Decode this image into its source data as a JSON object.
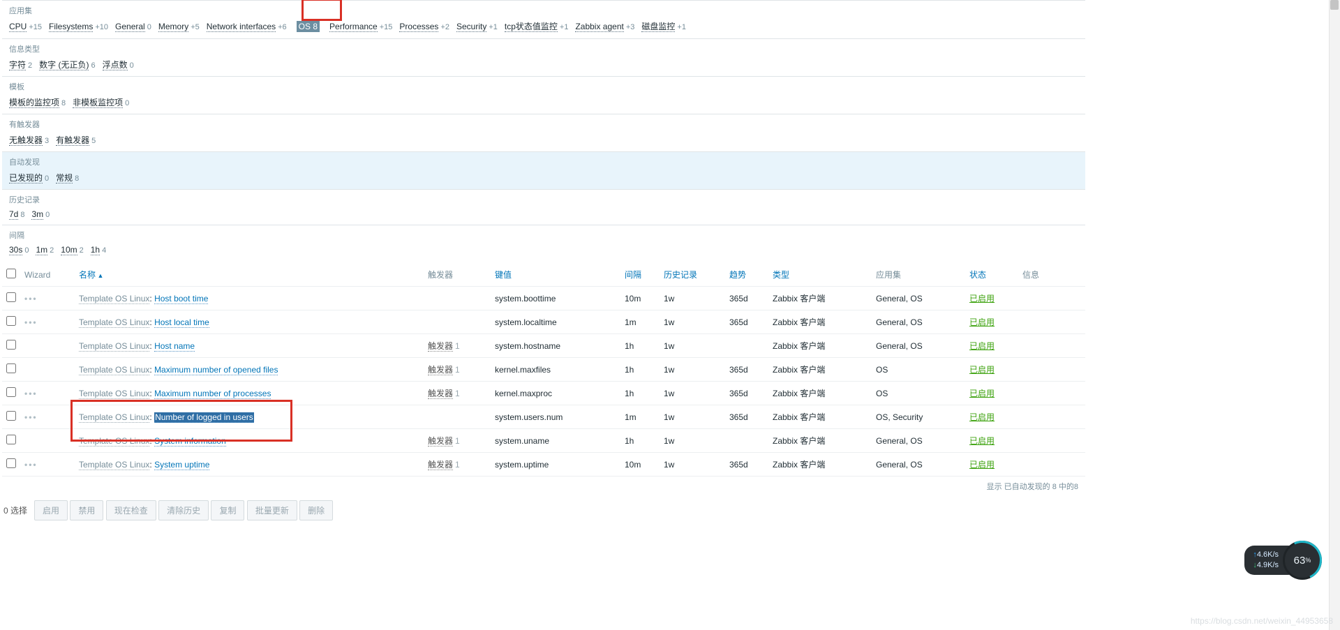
{
  "filters": {
    "app": {
      "label": "应用集",
      "items": [
        {
          "name": "CPU",
          "count": "+15"
        },
        {
          "name": "Filesystems",
          "count": "+10"
        },
        {
          "name": "General",
          "count": "0"
        },
        {
          "name": "Memory",
          "count": "+5"
        },
        {
          "name": "Network interfaces",
          "count": "+6"
        },
        {
          "name": "OS",
          "count": "8",
          "selected": true
        },
        {
          "name": "Performance",
          "count": "+15"
        },
        {
          "name": "Processes",
          "count": "+2"
        },
        {
          "name": "Security",
          "count": "+1"
        },
        {
          "name": "tcp状态值监控",
          "count": "+1"
        },
        {
          "name": "Zabbix agent",
          "count": "+3"
        },
        {
          "name": "磁盘监控",
          "count": "+1"
        }
      ]
    },
    "info": {
      "label": "信息类型",
      "items": [
        {
          "name": "字符",
          "count": "2"
        },
        {
          "name": "数字 (无正负)",
          "count": "6"
        },
        {
          "name": "浮点数",
          "count": "0"
        }
      ]
    },
    "tpl": {
      "label": "模板",
      "items": [
        {
          "name": "模板的监控项",
          "count": "8"
        },
        {
          "name": "非模板监控项",
          "count": "0"
        }
      ]
    },
    "trig": {
      "label": "有触发器",
      "items": [
        {
          "name": "无触发器",
          "count": "3"
        },
        {
          "name": "有触发器",
          "count": "5"
        }
      ]
    },
    "disc": {
      "label": "自动发现",
      "items": [
        {
          "name": "已发现的",
          "count": "0"
        },
        {
          "name": "常规",
          "count": "8"
        }
      ]
    },
    "hist": {
      "label": "历史记录",
      "items": [
        {
          "name": "7d",
          "count": "8"
        },
        {
          "name": "3m",
          "count": "0"
        }
      ]
    },
    "intv": {
      "label": "间隔",
      "items": [
        {
          "name": "30s",
          "count": "0"
        },
        {
          "name": "1m",
          "count": "2"
        },
        {
          "name": "10m",
          "count": "2"
        },
        {
          "name": "1h",
          "count": "4"
        }
      ]
    }
  },
  "columns": {
    "wizard": "Wizard",
    "name": "名称",
    "triggers": "触发器",
    "key": "键值",
    "interval": "间隔",
    "history": "历史记录",
    "trends": "趋势",
    "type": "类型",
    "applications": "应用集",
    "status": "状态",
    "info": "信息"
  },
  "common": {
    "template_prefix": "Template OS Linux",
    "colon": ": ",
    "trigger_label": "触发器",
    "trigger_count": "1",
    "type_value": "Zabbix 客户端",
    "enabled": "已启用",
    "dots": "•••"
  },
  "rows": [
    {
      "dots": true,
      "name": "Host boot time",
      "key": "system.boottime",
      "interval": "10m",
      "history": "1w",
      "trends": "365d",
      "apps": "General, OS",
      "trig": false
    },
    {
      "dots": true,
      "name": "Host local time",
      "key": "system.localtime",
      "interval": "1m",
      "history": "1w",
      "trends": "365d",
      "apps": "General, OS",
      "trig": false
    },
    {
      "dots": false,
      "name": "Host name",
      "key": "system.hostname",
      "interval": "1h",
      "history": "1w",
      "trends": "",
      "apps": "General, OS",
      "trig": true
    },
    {
      "dots": false,
      "name": "Maximum number of opened files",
      "key": "kernel.maxfiles",
      "interval": "1h",
      "history": "1w",
      "trends": "365d",
      "apps": "OS",
      "trig": true
    },
    {
      "dots": true,
      "name": "Maximum number of processes",
      "key": "kernel.maxproc",
      "interval": "1h",
      "history": "1w",
      "trends": "365d",
      "apps": "OS",
      "trig": true
    },
    {
      "dots": true,
      "name": "Number of logged in users",
      "key": "system.users.num",
      "interval": "1m",
      "history": "1w",
      "trends": "365d",
      "apps": "OS, Security",
      "trig": false,
      "selected": true
    },
    {
      "dots": false,
      "name": "System information",
      "key": "system.uname",
      "interval": "1h",
      "history": "1w",
      "trends": "",
      "apps": "General, OS",
      "trig": true
    },
    {
      "dots": true,
      "name": "System uptime",
      "key": "system.uptime",
      "interval": "10m",
      "history": "1w",
      "trends": "365d",
      "apps": "General, OS",
      "trig": true
    }
  ],
  "footer": {
    "selected": "0 选择",
    "buttons": [
      "启用",
      "禁用",
      "现在检查",
      "清除历史",
      "复制",
      "批量更新",
      "删除"
    ],
    "note": "显示 已自动发现的 8 中的8"
  },
  "widget": {
    "up": "4.6K/s",
    "down": "4.9K/s",
    "pct": "63",
    "pct_suffix": "%"
  },
  "watermark": "https://blog.csdn.net/weixin_44953658"
}
